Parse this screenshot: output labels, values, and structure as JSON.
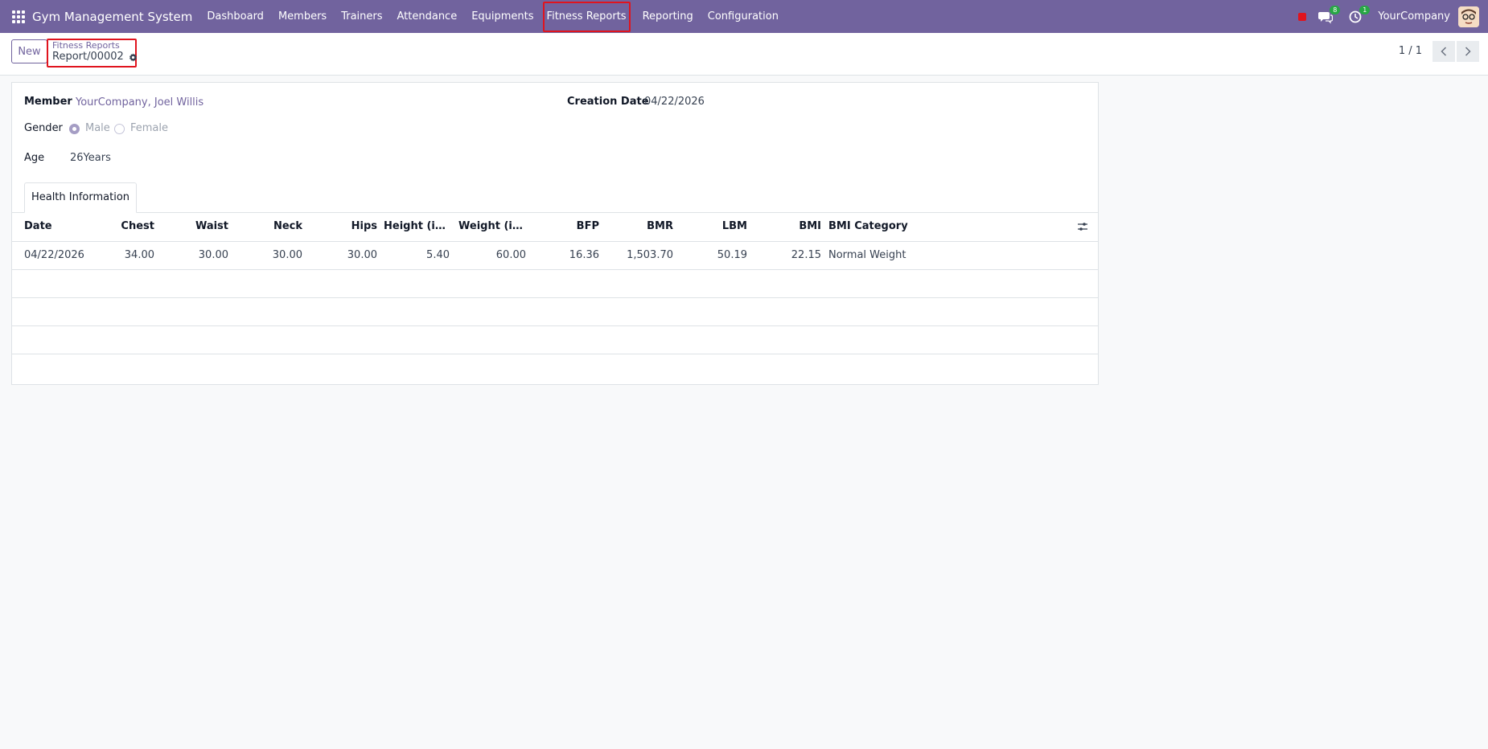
{
  "navbar": {
    "brand": "Gym Management System",
    "menu": [
      {
        "label": "Dashboard"
      },
      {
        "label": "Members"
      },
      {
        "label": "Trainers"
      },
      {
        "label": "Attendance"
      },
      {
        "label": "Equipments"
      },
      {
        "label": "Fitness Reports",
        "active": true
      },
      {
        "label": "Reporting"
      },
      {
        "label": "Configuration"
      }
    ],
    "messages_badge": "8",
    "activities_badge": "1",
    "company": "YourCompany"
  },
  "control_panel": {
    "new_label": "New",
    "breadcrumb_parent": "Fitness Reports",
    "breadcrumb_current": "Report/00002",
    "pager": "1 / 1"
  },
  "form": {
    "member_label": "Member",
    "member_value": "YourCompany, Joel Willis",
    "creation_date_label": "Creation Date",
    "creation_date_value": "04/22/2026",
    "gender_label": "Gender",
    "gender_options": [
      "Male",
      "Female"
    ],
    "gender_selected": "Male",
    "age_label": "Age",
    "age_value": "26Years",
    "tab_label": "Health Information"
  },
  "table": {
    "columns": [
      "Date",
      "Chest",
      "Waist",
      "Neck",
      "Hips",
      "Height (in I...",
      "Weight (in k...",
      "BFP",
      "BMR",
      "LBM",
      "BMI",
      "BMI Category"
    ],
    "rows": [
      [
        "04/22/2026",
        "34.00",
        "30.00",
        "30.00",
        "30.00",
        "5.40",
        "60.00",
        "16.36",
        "1,503.70",
        "50.19",
        "22.15",
        "Normal Weight"
      ]
    ]
  },
  "colors": {
    "brand": "#71639e",
    "highlight": "#e0141e",
    "badge": "#28a745"
  }
}
